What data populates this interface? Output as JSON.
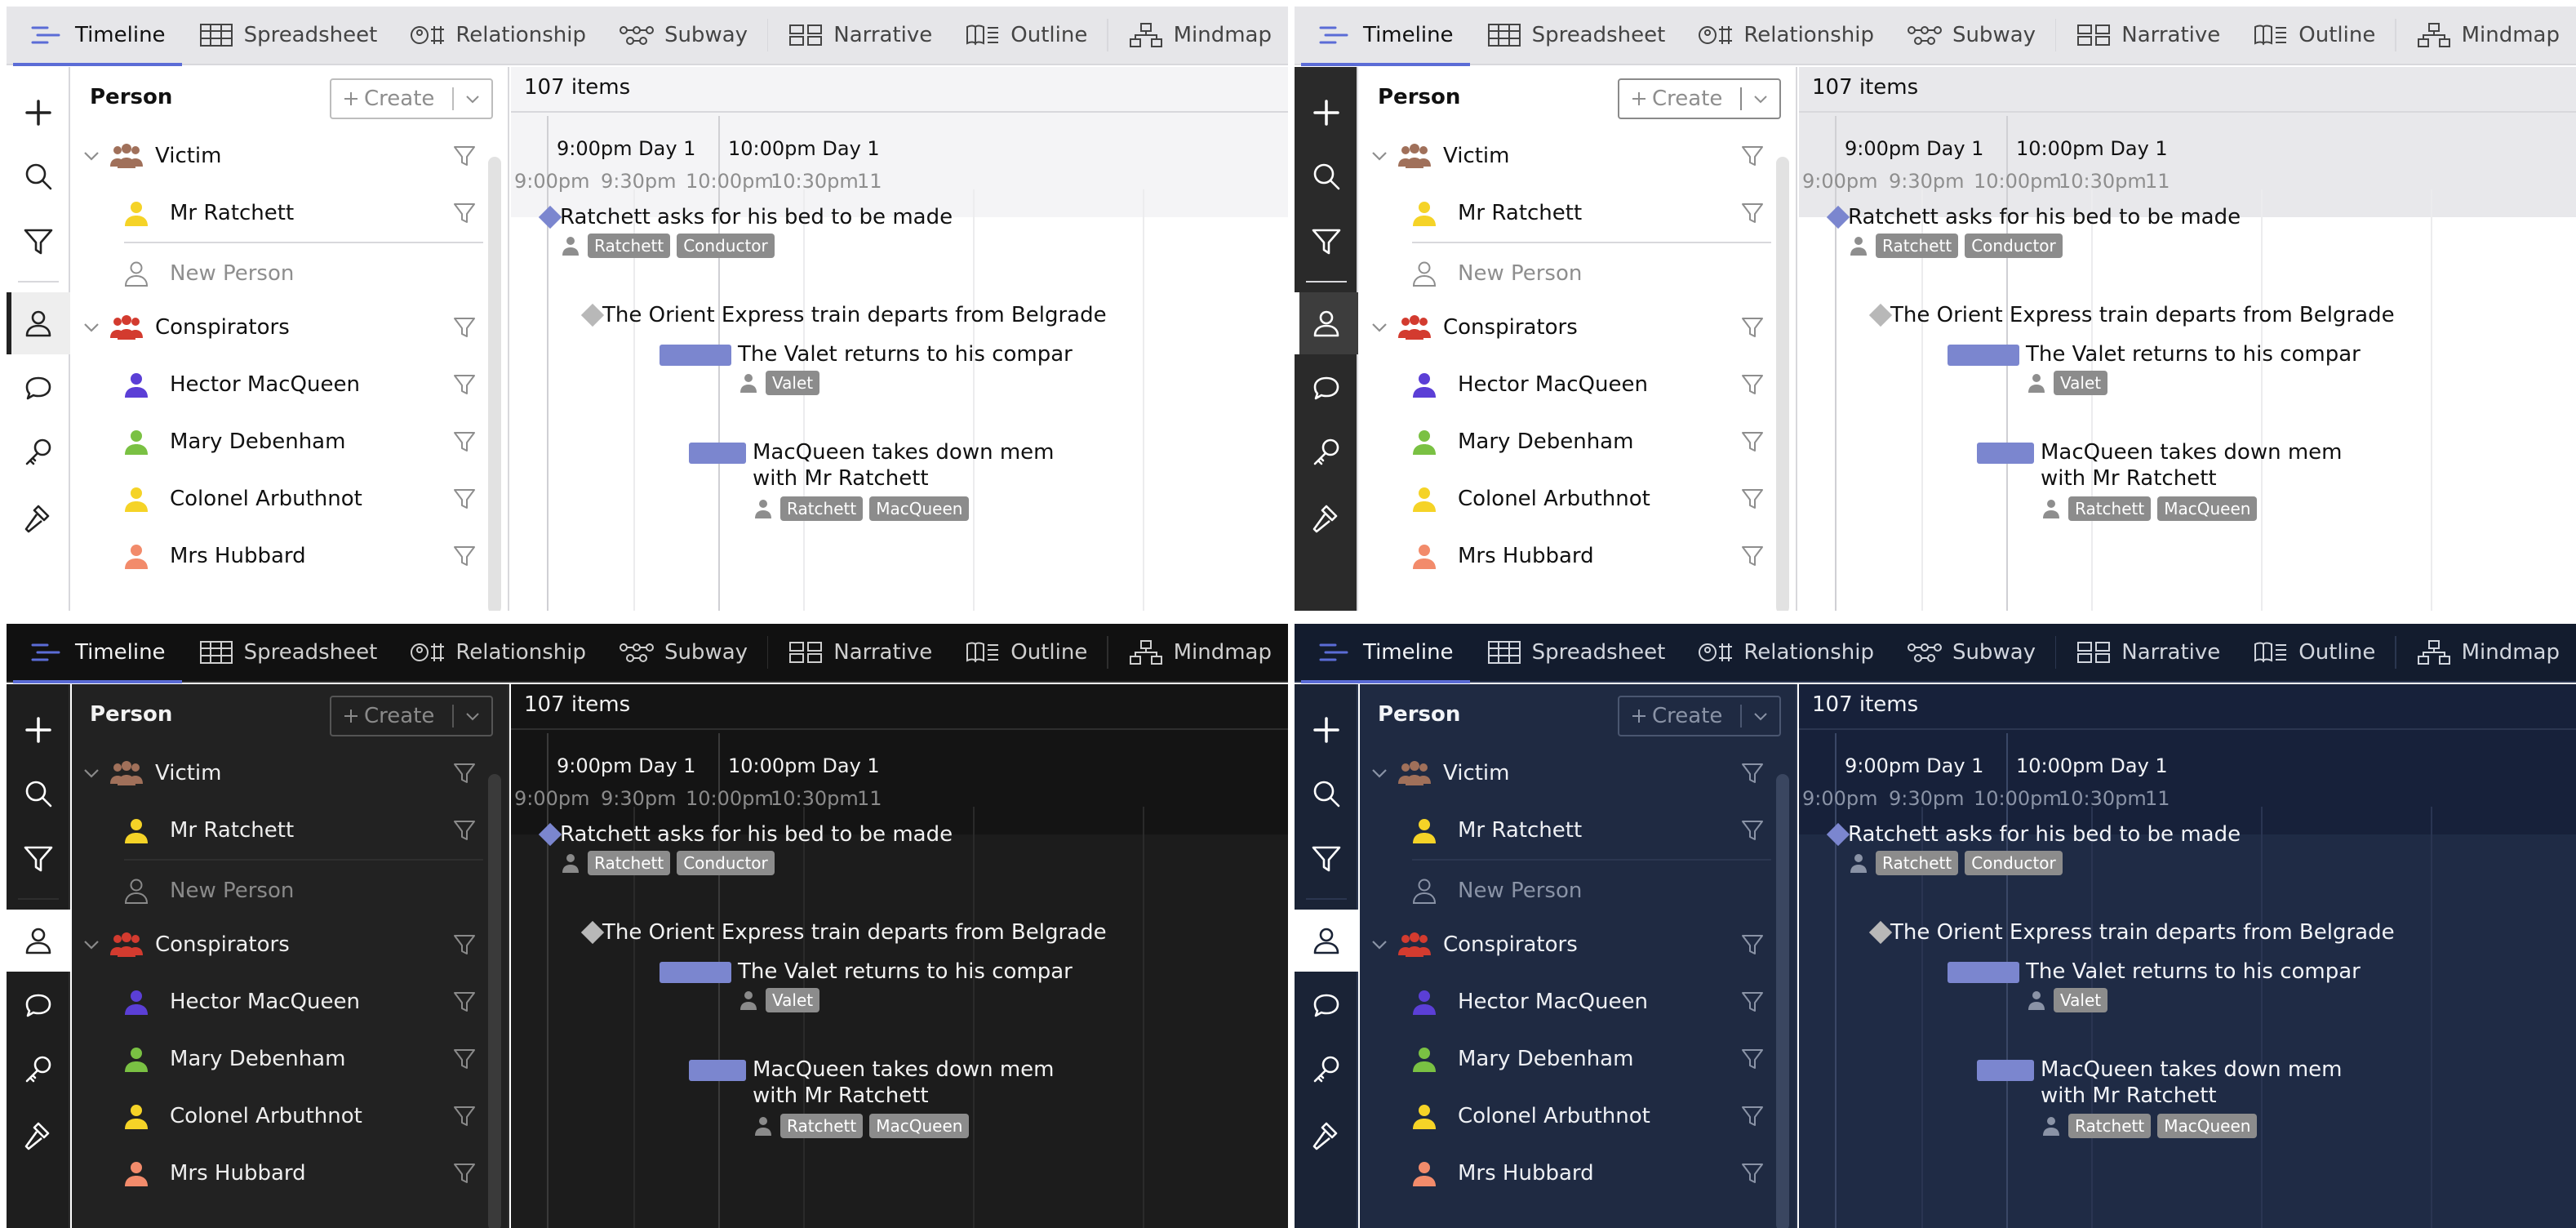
{
  "tabs": [
    {
      "label": "Timeline",
      "icon": "timeline-icon",
      "active": true
    },
    {
      "label": "Spreadsheet",
      "icon": "spreadsheet-icon"
    },
    {
      "label": "Relationship",
      "icon": "relationship-icon"
    },
    {
      "label": "Subway",
      "icon": "subway-icon"
    },
    {
      "label": "Narrative",
      "icon": "narrative-icon"
    },
    {
      "label": "Outline",
      "icon": "outline-icon"
    },
    {
      "label": "Mindmap",
      "icon": "mindmap-icon"
    }
  ],
  "rail": [
    "add-icon",
    "search-icon",
    "filter-icon",
    "person-icon",
    "comment-icon",
    "key-icon",
    "hammer-icon"
  ],
  "list": {
    "title": "Person",
    "create_label": "Create",
    "groups": [
      {
        "label": "Victim",
        "color": "#a0705a",
        "items": [
          {
            "label": "Mr Ratchett",
            "color": "#f5d327"
          }
        ],
        "new_item": "New Person"
      },
      {
        "label": "Conspirators",
        "color": "#d33b2f",
        "items": [
          {
            "label": "Hector MacQueen",
            "color": "#5b3fd6"
          },
          {
            "label": "Mary Debenham",
            "color": "#7ac143"
          },
          {
            "label": "Colonel Arbuthnot",
            "color": "#f5d327"
          },
          {
            "label": "Mrs Hubbard",
            "color": "#f28b6b"
          }
        ]
      }
    ]
  },
  "timeline": {
    "count": "107 items",
    "major": [
      "9:00pm Day 1",
      "10:00pm Day 1"
    ],
    "minor": [
      "9:00pm",
      "9:30pm",
      "10:00pm",
      "10:30pm",
      "11"
    ],
    "events": [
      {
        "title": "Ratchett asks for his bed to be made",
        "chips": [
          "Ratchett",
          "Conductor"
        ],
        "kind": "diamond",
        "color": "#7b86cf"
      },
      {
        "title": "The Orient Express train departs from Belgrade",
        "chips": [],
        "kind": "diamond",
        "color": "#b8b8b8"
      },
      {
        "title": "The Valet returns to his compar",
        "chips": [
          "Valet"
        ],
        "kind": "bar",
        "color": "#7b86cf"
      },
      {
        "title": "MacQueen takes down mem",
        "title2": "with Mr Ratchett",
        "chips": [
          "Ratchett",
          "MacQueen"
        ],
        "kind": "bar",
        "color": "#7b86cf"
      }
    ]
  }
}
